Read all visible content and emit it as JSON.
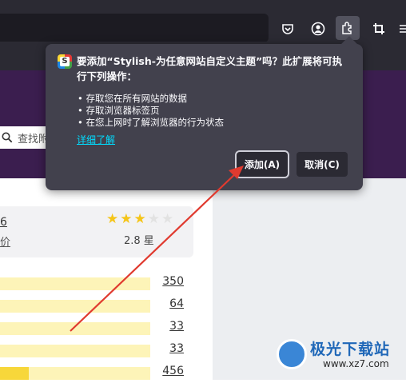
{
  "browser": {
    "icons": [
      "pocket-icon",
      "account-icon",
      "extensions-icon",
      "crop-icon",
      "menu-icon"
    ]
  },
  "page": {
    "search_placeholder": "查找附",
    "rating": {
      "count_fragment": "6",
      "label_fragment": "价",
      "stars_filled": 2.8,
      "stars_total": 5,
      "stars_text": "2.8 星"
    },
    "distribution": [
      {
        "count": "350",
        "fill_fraction": 0.0
      },
      {
        "count": "64",
        "fill_fraction": 0.0
      },
      {
        "count": "33",
        "fill_fraction": 0.0
      },
      {
        "count": "33",
        "fill_fraction": 0.0
      },
      {
        "count": "456",
        "fill_fraction": 0.19
      }
    ]
  },
  "popup": {
    "title": "要添加“Stylish-为任意网站自定义主题”吗？此扩展将可执行下列操作：",
    "permissions": [
      "存取您在所有网站的数据",
      "存取浏览器标签页",
      "在您上网时了解浏览器的行为状态"
    ],
    "learn_more": "详细了解",
    "add_button": "添加(A)",
    "cancel_button": "取消(C)",
    "icon_letter": "S"
  },
  "watermark": {
    "name": "极光下载站",
    "url": "www.xz7.com"
  },
  "colors": {
    "accent_link": "#00ddff",
    "page_band": "#3b1e4f",
    "annotation_arrow": "#e03a2f",
    "star": "#f5c518"
  }
}
